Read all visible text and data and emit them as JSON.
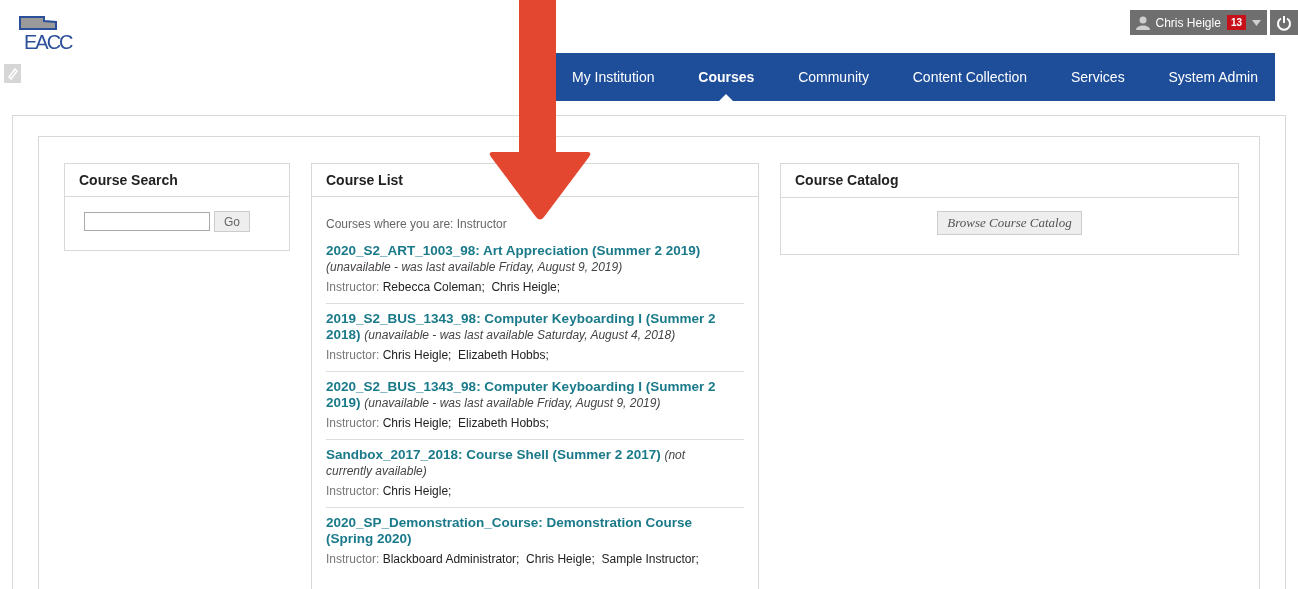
{
  "header": {
    "logo": "EACC",
    "user": {
      "name": "Chris Heigle",
      "badge": "13"
    }
  },
  "nav": {
    "tabs": [
      {
        "label": "My Institution",
        "selected": false
      },
      {
        "label": "Courses",
        "selected": true
      },
      {
        "label": "Community",
        "selected": false
      },
      {
        "label": "Content Collection",
        "selected": false
      },
      {
        "label": "Services",
        "selected": false
      },
      {
        "label": "System Admin",
        "selected": false
      }
    ]
  },
  "course_search": {
    "title": "Course Search",
    "button": "Go"
  },
  "course_list": {
    "title": "Course List",
    "intro": "Courses where you are: Instructor",
    "courses": [
      {
        "title": "2020_S2_ART_1003_98: Art Appreciation (Summer 2 2019)",
        "note": "(unavailable - was last available Friday, August 9, 2019)",
        "instructor_label": "Instructor:",
        "instructors": "Rebecca Coleman;  Chris Heigle;"
      },
      {
        "title": "2019_S2_BUS_1343_98: Computer Keyboarding I (Summer 2 2018)",
        "note": "(unavailable - was last available Saturday, August 4, 2018)",
        "instructor_label": "Instructor:",
        "instructors": "Chris Heigle;  Elizabeth Hobbs;"
      },
      {
        "title": "2020_S2_BUS_1343_98: Computer Keyboarding I (Summer 2 2019)",
        "note": "(unavailable - was last available Friday, August 9, 2019)",
        "instructor_label": "Instructor:",
        "instructors": "Chris Heigle;  Elizabeth Hobbs;"
      },
      {
        "title": "Sandbox_2017_2018: Course Shell (Summer 2 2017)",
        "note": "(not currently available)",
        "instructor_label": "Instructor:",
        "instructors": "Chris Heigle;"
      },
      {
        "title": "2020_SP_Demonstration_Course: Demonstration Course (Spring 2020)",
        "instructor_label": "Instructor:",
        "instructors": "Blackboard Administrator;  Chris Heigle;  Sample Instructor;"
      }
    ]
  },
  "course_catalog": {
    "title": "Course Catalog",
    "button": "Browse Course Catalog"
  }
}
